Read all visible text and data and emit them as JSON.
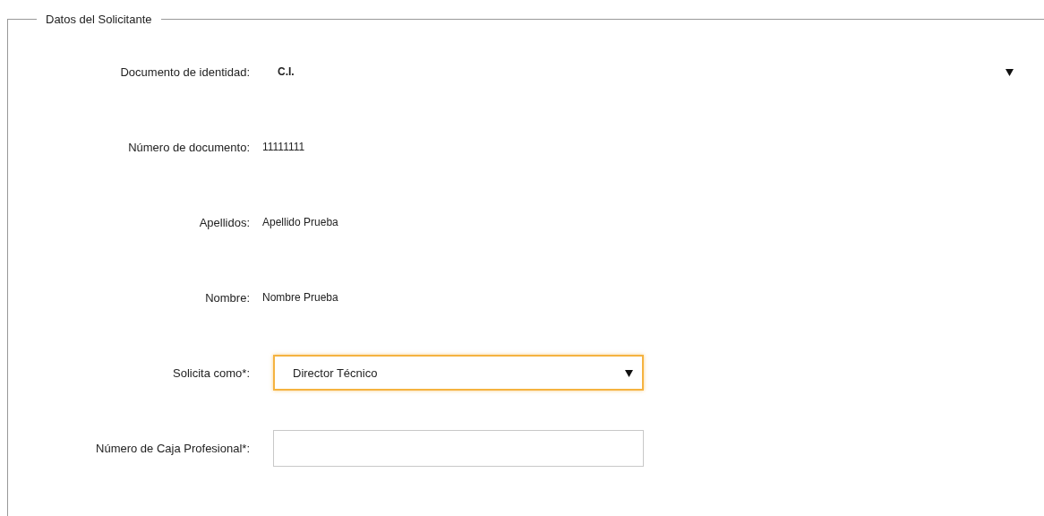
{
  "section": {
    "title": "Datos del Solicitante"
  },
  "fields": [
    {
      "kind": "plain-select",
      "label": "Documento de identidad:",
      "value": "C.I."
    },
    {
      "kind": "text",
      "label": "Número de documento:",
      "value": "11111111"
    },
    {
      "kind": "text",
      "label": "Apellidos:",
      "value": "Apellido Prueba"
    },
    {
      "kind": "text",
      "label": "Nombre:",
      "value": "Nombre Prueba"
    },
    {
      "kind": "select",
      "label": "Solicita como*:",
      "value": "Director Técnico",
      "focused": true
    },
    {
      "kind": "input",
      "label": "Número de Caja Profesional*:",
      "focused": false
    }
  ]
}
